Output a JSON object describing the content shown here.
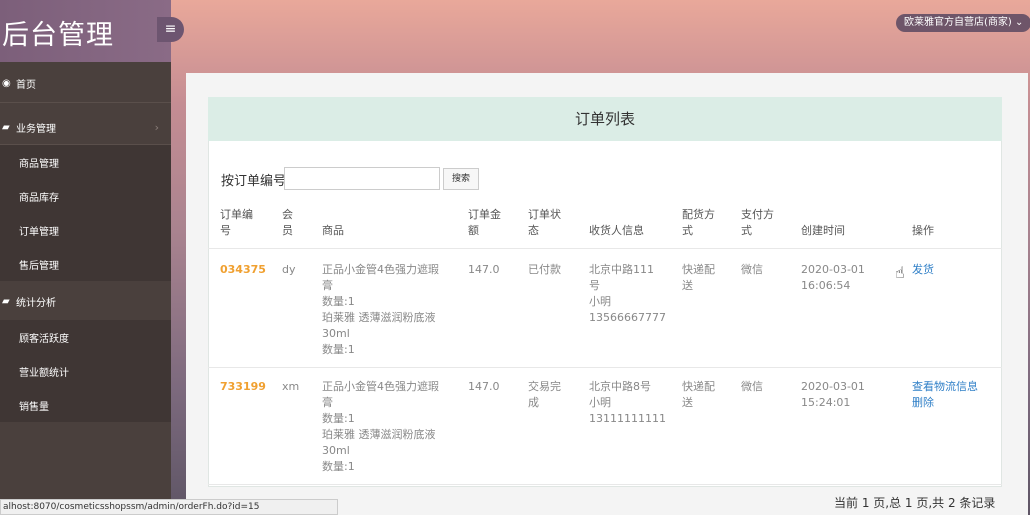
{
  "brand": {
    "title": "后台管理",
    "toggle_icon": "≡"
  },
  "sidebar": {
    "items": [
      {
        "label": "首页",
        "icon": "dashboard-icon"
      },
      {
        "label": "业务管理",
        "icon": "book-icon",
        "arrow": "›"
      },
      {
        "label": "商品管理"
      },
      {
        "label": "商品库存"
      },
      {
        "label": "订单管理"
      },
      {
        "label": "售后管理"
      },
      {
        "label": "统计分析",
        "icon": "book-icon"
      },
      {
        "label": "顾客活跃度"
      },
      {
        "label": "营业额统计"
      },
      {
        "label": "销售量"
      }
    ]
  },
  "topbar": {
    "user": "欧莱雅官方自营店(商家) ⌄"
  },
  "panel": {
    "title": "订单列表"
  },
  "search": {
    "label": "按订单编号",
    "value": "",
    "button": "搜索"
  },
  "table": {
    "headers": {
      "orderno": [
        "订单编",
        "号"
      ],
      "member": [
        "会",
        "员"
      ],
      "goods": "商品",
      "amount": [
        "订单金",
        "额"
      ],
      "status": [
        "订单状",
        "态"
      ],
      "receiver": "收货人信息",
      "ship": [
        "配货方",
        "式"
      ],
      "pay": [
        "支付方",
        "式"
      ],
      "created": "创建时间",
      "action": "操作"
    },
    "rows": [
      {
        "orderno": "034375",
        "member": "dy",
        "goods": [
          "正品小金管4色强力遮瑕",
          "膏",
          "数量:1",
          "珀莱雅 透薄滋润粉底液",
          "30ml",
          "数量:1"
        ],
        "amount": "147.0",
        "status": [
          "已付款"
        ],
        "receiver": [
          "北京中路111",
          "号",
          "小明",
          "13566667777"
        ],
        "ship": [
          "快递配",
          "送"
        ],
        "pay": "微信",
        "created": [
          "2020-03-01",
          "16:06:54"
        ],
        "actions": [
          "发货"
        ]
      },
      {
        "orderno": "733199",
        "member": "xm",
        "goods": [
          "正品小金管4色强力遮瑕",
          "膏",
          "数量:1",
          "珀莱雅 透薄滋润粉底液",
          "30ml",
          "数量:1"
        ],
        "amount": "147.0",
        "status": [
          "交易完",
          "成"
        ],
        "receiver": [
          "北京中路8号",
          "小明",
          "13111111111"
        ],
        "ship": [
          "快递配",
          "送"
        ],
        "pay": "微信",
        "created": [
          "2020-03-01",
          "15:24:01"
        ],
        "actions": [
          "查看物流信息",
          "删除"
        ]
      }
    ]
  },
  "pager": "当前 1 页,总 1 页,共 2 条记录",
  "statusbar": "alhost:8070/cosmeticsshopssm/admin/orderFh.do?id=15"
}
